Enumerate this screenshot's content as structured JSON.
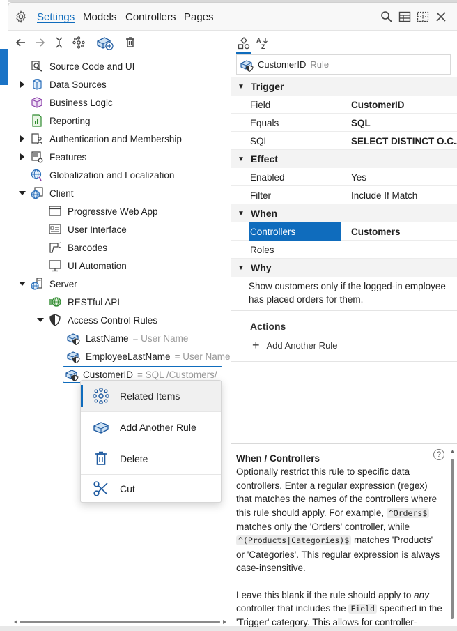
{
  "menu": {
    "items": [
      "Settings",
      "Models",
      "Controllers",
      "Pages"
    ]
  },
  "tree": {
    "nodes": [
      {
        "label": "Source Code and UI",
        "hint": ""
      },
      {
        "label": "Data Sources",
        "hint": ""
      },
      {
        "label": "Business Logic",
        "hint": ""
      },
      {
        "label": "Reporting",
        "hint": ""
      },
      {
        "label": "Authentication and Membership",
        "hint": ""
      },
      {
        "label": "Features",
        "hint": ""
      },
      {
        "label": "Globalization and Localization",
        "hint": ""
      },
      {
        "label": "Client",
        "hint": ""
      },
      {
        "label": "Progressive Web App",
        "hint": ""
      },
      {
        "label": "User Interface",
        "hint": ""
      },
      {
        "label": "Barcodes",
        "hint": ""
      },
      {
        "label": "UI Automation",
        "hint": ""
      },
      {
        "label": "Server",
        "hint": ""
      },
      {
        "label": "RESTful API",
        "hint": ""
      },
      {
        "label": "Access Control Rules",
        "hint": ""
      },
      {
        "label": "LastName",
        "hint": "= User Name"
      },
      {
        "label": "EmployeeLastName",
        "hint": "= User Name"
      },
      {
        "label": "CustomerID",
        "hint": "= SQL /Customers/"
      }
    ]
  },
  "context_menu": {
    "items": [
      "Related Items",
      "Add Another Rule",
      "Delete",
      "Cut"
    ]
  },
  "properties": {
    "header": {
      "name": "CustomerID",
      "type": "Rule"
    },
    "categories": [
      "Trigger",
      "Effect",
      "When",
      "Why"
    ],
    "trigger": [
      {
        "key": "Field",
        "value": "CustomerID"
      },
      {
        "key": "Equals",
        "value": "SQL"
      },
      {
        "key": "SQL",
        "value": "SELECT DISTINCT O.C..."
      }
    ],
    "effect": [
      {
        "key": "Enabled",
        "value": "Yes"
      },
      {
        "key": "Filter",
        "value": "Include If Match"
      }
    ],
    "when": [
      {
        "key": "Controllers",
        "value": "Customers"
      },
      {
        "key": "Roles",
        "value": ""
      }
    ],
    "why_text": "Show customers only if the logged-in employee has placed orders for them.",
    "actions_label": "Actions",
    "add_rule_label": "Add Another Rule"
  },
  "help": {
    "title": "When / Controllers",
    "p1_a": "Optionally restrict this rule to specific data controllers. Enter a regular expression (regex) that matches the names of the controllers where this rule should apply. For example, ",
    "code1": "^Orders$",
    "p1_b": " matches only the 'Orders' controller, while ",
    "code2": "^(Products|Categories)$",
    "p1_c": " matches 'Products' or 'Categories'. This regular expression is always case-insensitive.",
    "p2_a": "Leave this blank if the rule should apply to ",
    "p2_em": "any",
    "p2_b": " controller that includes the ",
    "code3": "Field",
    "p2_c": " specified in the 'Trigger' category. This allows for controller-specific security logic when needed."
  }
}
